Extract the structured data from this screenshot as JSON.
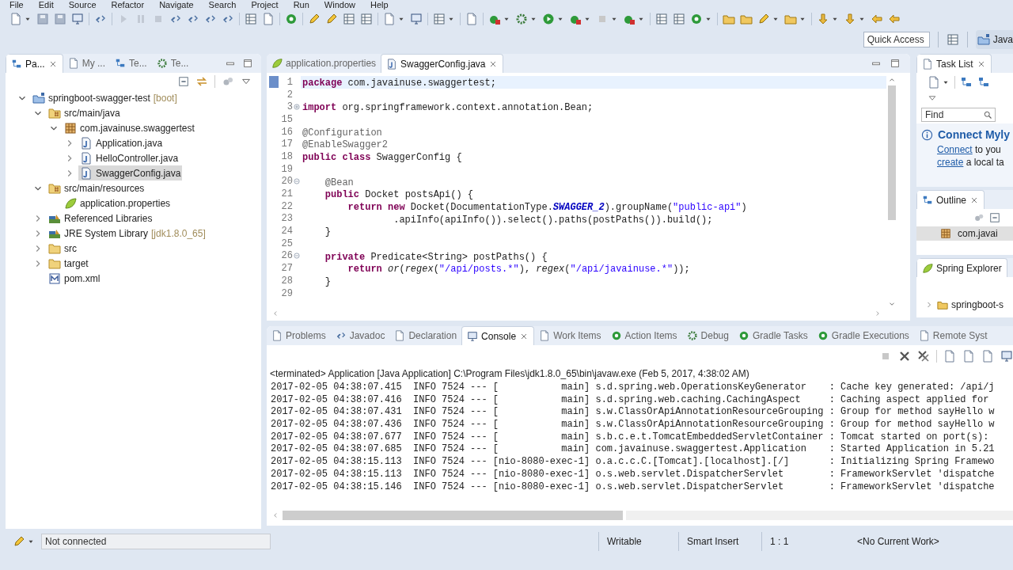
{
  "menu": [
    "File",
    "Edit",
    "Source",
    "Refactor",
    "Navigate",
    "Search",
    "Project",
    "Run",
    "Window",
    "Help"
  ],
  "quick_access": {
    "placeholder": "Quick Access"
  },
  "perspective": {
    "label": "Java"
  },
  "explorer": {
    "tabs": [
      {
        "label": "Pa...",
        "selected": true
      },
      {
        "label": "My ...",
        "selected": false
      },
      {
        "label": "Te...",
        "selected": false
      },
      {
        "label": "Te...",
        "selected": false
      }
    ],
    "tree": [
      {
        "label": "springboot-swagger-test",
        "decoration": "[boot]",
        "kind": "project",
        "expanded": true,
        "selected": false,
        "children": [
          {
            "label": "src/main/java",
            "kind": "source-folder",
            "expanded": true,
            "selected": false,
            "children": [
              {
                "label": "com.javainuse.swaggertest",
                "kind": "package",
                "expanded": true,
                "selected": false,
                "children": [
                  {
                    "label": "Application.java",
                    "kind": "java",
                    "expanded": false,
                    "selected": false
                  },
                  {
                    "label": "HelloController.java",
                    "kind": "java",
                    "expanded": false,
                    "selected": false
                  },
                  {
                    "label": "SwaggerConfig.java",
                    "kind": "java",
                    "expanded": false,
                    "selected": true
                  }
                ]
              }
            ]
          },
          {
            "label": "src/main/resources",
            "kind": "source-folder",
            "expanded": true,
            "selected": false,
            "children": [
              {
                "label": "application.properties",
                "kind": "leaf",
                "selected": false
              }
            ]
          },
          {
            "label": "Referenced Libraries",
            "kind": "library",
            "expanded": false,
            "selected": false
          },
          {
            "label": "JRE System Library",
            "decoration": "[jdk1.8.0_65]",
            "kind": "library",
            "expanded": false,
            "selected": false
          },
          {
            "label": "src",
            "kind": "folder",
            "expanded": false,
            "selected": false
          },
          {
            "label": "target",
            "kind": "folder",
            "expanded": false,
            "selected": false
          },
          {
            "label": "pom.xml",
            "kind": "xml",
            "selected": false
          }
        ]
      }
    ]
  },
  "editor": {
    "tabs": [
      {
        "label": "application.properties",
        "kind": "leaf",
        "selected": false
      },
      {
        "label": "SwaggerConfig.java",
        "kind": "java",
        "selected": true
      }
    ],
    "lines": [
      {
        "number": "1",
        "current": true,
        "tokens": [
          {
            "kind": "kw",
            "text": "package"
          },
          {
            "kind": "plain",
            "text": " com.javainuse.swaggertest;"
          }
        ]
      },
      {
        "number": "2",
        "current": false
      },
      {
        "number": "3",
        "current": false,
        "expanded": false,
        "tokens": [
          {
            "kind": "kw",
            "text": "import"
          },
          {
            "kind": "plain",
            "text": " org.springframework.context.annotation.Bean;"
          }
        ]
      },
      {
        "number": "15",
        "current": false
      },
      {
        "number": "16",
        "current": false,
        "tokens": [
          {
            "kind": "ann",
            "text": "@Configuration"
          }
        ]
      },
      {
        "number": "17",
        "current": false,
        "tokens": [
          {
            "kind": "ann",
            "text": "@EnableSwagger2"
          }
        ]
      },
      {
        "number": "18",
        "current": false,
        "tokens": [
          {
            "kind": "kw",
            "text": "public class"
          },
          {
            "kind": "plain",
            "text": " SwaggerConfig {"
          }
        ]
      },
      {
        "number": "19",
        "current": false
      },
      {
        "number": "20",
        "current": false,
        "expanded": true,
        "tokens": [
          {
            "kind": "ann",
            "text": "    @Bean"
          }
        ]
      },
      {
        "number": "21",
        "current": false,
        "tokens": [
          {
            "kind": "kw",
            "text": "    public"
          },
          {
            "kind": "plain",
            "text": " Docket postsApi() {"
          }
        ]
      },
      {
        "number": "22",
        "current": false,
        "tokens": [
          {
            "kind": "kw",
            "text": "        return new"
          },
          {
            "kind": "plain",
            "text": " Docket(DocumentationType."
          },
          {
            "kind": "const",
            "text": "SWAGGER_2"
          },
          {
            "kind": "plain",
            "text": ").groupName("
          },
          {
            "kind": "str",
            "text": "\"public-api\""
          },
          {
            "kind": "plain",
            "text": ")"
          }
        ]
      },
      {
        "number": "23",
        "current": false,
        "tokens": [
          {
            "kind": "plain",
            "text": "                .apiInfo(apiInfo()).select().paths(postPaths()).build();"
          }
        ]
      },
      {
        "number": "24",
        "current": false,
        "tokens": [
          {
            "kind": "plain",
            "text": "    }"
          }
        ]
      },
      {
        "number": "25",
        "current": false
      },
      {
        "number": "26",
        "current": false,
        "expanded": true,
        "tokens": [
          {
            "kind": "kw",
            "text": "    private"
          },
          {
            "kind": "plain",
            "text": " Predicate<String> postPaths() {"
          }
        ]
      },
      {
        "number": "27",
        "current": false,
        "tokens": [
          {
            "kind": "kw",
            "text": "        return "
          },
          {
            "kind": "ital",
            "text": "or"
          },
          {
            "kind": "plain",
            "text": "("
          },
          {
            "kind": "ital",
            "text": "regex"
          },
          {
            "kind": "plain",
            "text": "("
          },
          {
            "kind": "str",
            "text": "\"/api/posts.*\""
          },
          {
            "kind": "plain",
            "text": "), "
          },
          {
            "kind": "ital",
            "text": "regex"
          },
          {
            "kind": "plain",
            "text": "("
          },
          {
            "kind": "str",
            "text": "\"/api/javainuse.*\""
          },
          {
            "kind": "plain",
            "text": "));"
          }
        ]
      },
      {
        "number": "28",
        "current": false,
        "tokens": [
          {
            "kind": "plain",
            "text": "    }"
          }
        ]
      },
      {
        "number": "29",
        "current": false
      }
    ]
  },
  "task_list": {
    "title": "Task List",
    "find": {
      "placeholder": "Find"
    },
    "connect_title": "Connect Myly",
    "connect_lines": [
      {
        "link": "Connect",
        "rest": " to you"
      },
      {
        "link": "create",
        "rest": " a local ta"
      }
    ]
  },
  "outline": {
    "title": "Outline",
    "items": [
      {
        "label": "com.javai",
        "selected": true
      }
    ]
  },
  "spring_explorer": {
    "title": "Spring Explorer",
    "items": [
      {
        "label": "springboot-s",
        "expanded": false
      }
    ]
  },
  "console": {
    "tabs": [
      {
        "label": "Problems",
        "selected": false
      },
      {
        "label": "Javadoc",
        "selected": false
      },
      {
        "label": "Declaration",
        "selected": false
      },
      {
        "label": "Console",
        "selected": true
      },
      {
        "label": "Work Items",
        "selected": false
      },
      {
        "label": "Action Items",
        "selected": false
      },
      {
        "label": "Debug",
        "selected": false
      },
      {
        "label": "Gradle Tasks",
        "selected": false
      },
      {
        "label": "Gradle Executions",
        "selected": false
      },
      {
        "label": "Remote Syst",
        "selected": false
      }
    ],
    "header": "<terminated> Application [Java Application] C:\\Program Files\\jdk1.8.0_65\\bin\\javaw.exe (Feb 5, 2017, 4:38:02 AM)",
    "lines": [
      "2017-02-05 04:38:07.415  INFO 7524 --- [           main] s.d.spring.web.OperationsKeyGenerator    : Cache key generated: /api/j",
      "2017-02-05 04:38:07.416  INFO 7524 --- [           main] s.d.spring.web.caching.CachingAspect     : Caching aspect applied for",
      "2017-02-05 04:38:07.431  INFO 7524 --- [           main] s.w.ClassOrApiAnnotationResourceGrouping : Group for method sayHello w",
      "2017-02-05 04:38:07.436  INFO 7524 --- [           main] s.w.ClassOrApiAnnotationResourceGrouping : Group for method sayHello w",
      "2017-02-05 04:38:07.677  INFO 7524 --- [           main] s.b.c.e.t.TomcatEmbeddedServletContainer : Tomcat started on port(s):",
      "2017-02-05 04:38:07.685  INFO 7524 --- [           main] com.javainuse.swaggertest.Application    : Started Application in 5.21",
      "2017-02-05 04:38:15.113  INFO 7524 --- [nio-8080-exec-1] o.a.c.c.C.[Tomcat].[localhost].[/]       : Initializing Spring Framewo",
      "2017-02-05 04:38:15.113  INFO 7524 --- [nio-8080-exec-1] o.s.web.servlet.DispatcherServlet        : FrameworkServlet 'dispatche",
      "2017-02-05 04:38:15.146  INFO 7524 --- [nio-8080-exec-1] o.s.web.servlet.DispatcherServlet        : FrameworkServlet 'dispatche"
    ]
  },
  "status_bar": {
    "connection": "Not connected",
    "items": [
      "Writable",
      "Smart Insert",
      "1 : 1"
    ],
    "work": "<No Current Work>"
  }
}
